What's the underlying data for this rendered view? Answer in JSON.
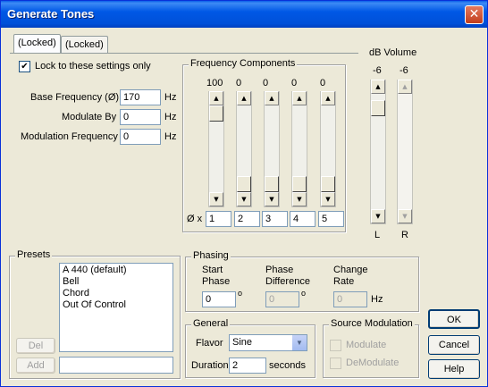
{
  "window": {
    "title": "Generate Tones",
    "close_label": "✕"
  },
  "tabs": [
    {
      "label": "(Locked)"
    },
    {
      "label": "(Locked)"
    }
  ],
  "lock": {
    "label": "Lock to these settings only",
    "checked": "✔"
  },
  "base_frequency": {
    "label": "Base Frequency (Ø)",
    "value": "170",
    "unit": "Hz"
  },
  "modulate_by": {
    "label": "Modulate By",
    "value": "0",
    "unit": "Hz"
  },
  "modulation_frequency": {
    "label": "Modulation Frequency",
    "value": "0",
    "unit": "Hz"
  },
  "frequency_components": {
    "title": "Frequency Components",
    "multiplier_label": "Ø x",
    "sliders": [
      {
        "level": "100",
        "multiplier": "1"
      },
      {
        "level": "0",
        "multiplier": "2"
      },
      {
        "level": "0",
        "multiplier": "3"
      },
      {
        "level": "0",
        "multiplier": "4"
      },
      {
        "level": "0",
        "multiplier": "5"
      }
    ]
  },
  "volume": {
    "title": "dB Volume",
    "left": {
      "level": "-6",
      "label": "L"
    },
    "right": {
      "level": "-6",
      "label": "R"
    }
  },
  "presets": {
    "title": "Presets",
    "items": [
      "A 440 (default)",
      "Bell",
      "Chord",
      "Out Of Control"
    ],
    "del_label": "Del",
    "add_label": "Add",
    "new_name_value": ""
  },
  "phasing": {
    "title": "Phasing",
    "start_phase_label_1": "Start",
    "start_phase_label_2": "Phase",
    "start_phase_value": "0",
    "start_phase_unit": "o",
    "phase_diff_label_1": "Phase",
    "phase_diff_label_2": "Difference",
    "phase_diff_value": "0",
    "phase_diff_unit": "o",
    "change_rate_label_1": "Change",
    "change_rate_label_2": "Rate",
    "change_rate_value": "0",
    "change_rate_unit": "Hz"
  },
  "general": {
    "title": "General",
    "flavor_label": "Flavor",
    "flavor_value": "Sine",
    "duration_label": "Duration",
    "duration_value": "2",
    "duration_unit": "seconds"
  },
  "source_modulation": {
    "title": "Source Modulation",
    "modulate_label": "Modulate",
    "demodulate_label": "DeModulate"
  },
  "buttons": {
    "ok": "OK",
    "cancel": "Cancel",
    "help": "Help"
  },
  "icons": {
    "arrow_up": "▲",
    "arrow_down": "▼"
  }
}
